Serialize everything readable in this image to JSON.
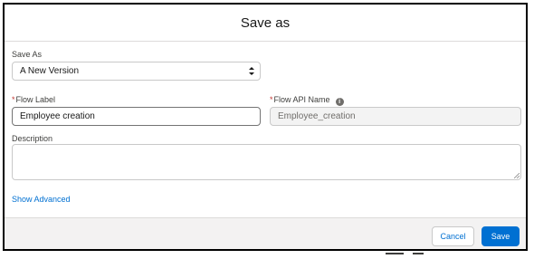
{
  "dialog": {
    "title": "Save as"
  },
  "save_as": {
    "label": "Save As",
    "selected": "A New Version"
  },
  "flow_label": {
    "required_marker": "*",
    "label": "Flow Label",
    "value": "Employee creation"
  },
  "flow_api_name": {
    "required_marker": "*",
    "label": "Flow API Name",
    "info_icon": "info-icon",
    "value": "Employee_creation"
  },
  "description": {
    "label": "Description",
    "value": ""
  },
  "show_advanced": {
    "label": "Show Advanced"
  },
  "footer": {
    "cancel_label": "Cancel",
    "save_label": "Save"
  },
  "colors": {
    "brand": "#0070d2",
    "required": "#c23934",
    "footer_bg": "#f3f2f2",
    "readonly_bg": "#f3f3f3"
  }
}
